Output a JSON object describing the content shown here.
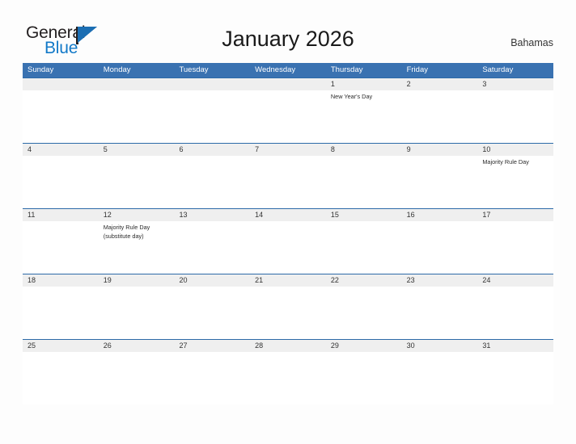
{
  "brand": {
    "name_top": "General",
    "name_bottom": "Blue",
    "accent_color": "#1279c8",
    "dark_color": "#231f20"
  },
  "header": {
    "title": "January 2026",
    "country": "Bahamas"
  },
  "theme": {
    "header_blue": "#3a72b1",
    "row_border_blue": "#2c6aa8",
    "day_band_gray": "#efefef",
    "page_background": "#fdfdfd"
  },
  "calendar": {
    "weekdays": [
      "Sunday",
      "Monday",
      "Tuesday",
      "Wednesday",
      "Thursday",
      "Friday",
      "Saturday"
    ],
    "weeks": [
      [
        {
          "day": ""
        },
        {
          "day": ""
        },
        {
          "day": ""
        },
        {
          "day": ""
        },
        {
          "day": "1",
          "events": [
            "New Year's Day"
          ]
        },
        {
          "day": "2"
        },
        {
          "day": "3"
        }
      ],
      [
        {
          "day": "4"
        },
        {
          "day": "5"
        },
        {
          "day": "6"
        },
        {
          "day": "7"
        },
        {
          "day": "8"
        },
        {
          "day": "9"
        },
        {
          "day": "10",
          "events": [
            "Majority Rule Day"
          ]
        }
      ],
      [
        {
          "day": "11"
        },
        {
          "day": "12",
          "events": [
            "Majority Rule Day",
            "(substitute day)"
          ]
        },
        {
          "day": "13"
        },
        {
          "day": "14"
        },
        {
          "day": "15"
        },
        {
          "day": "16"
        },
        {
          "day": "17"
        }
      ],
      [
        {
          "day": "18"
        },
        {
          "day": "19"
        },
        {
          "day": "20"
        },
        {
          "day": "21"
        },
        {
          "day": "22"
        },
        {
          "day": "23"
        },
        {
          "day": "24"
        }
      ],
      [
        {
          "day": "25"
        },
        {
          "day": "26"
        },
        {
          "day": "27"
        },
        {
          "day": "28"
        },
        {
          "day": "29"
        },
        {
          "day": "30"
        },
        {
          "day": "31"
        }
      ]
    ]
  }
}
